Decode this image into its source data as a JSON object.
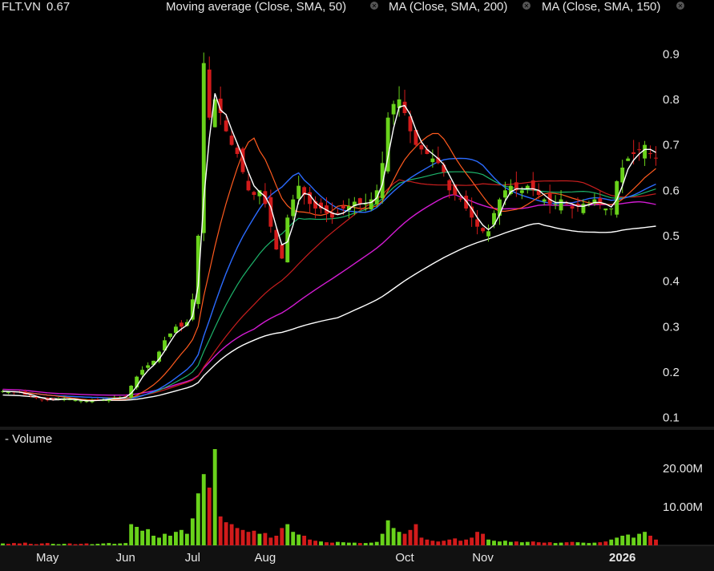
{
  "header": {
    "symbol": "FLT.VN",
    "last": "0.67",
    "indicators": [
      {
        "label": "Moving average (Close, SMA, 50)",
        "color": "#2b6bff"
      },
      {
        "label": "MA (Close, SMA, 200)",
        "color": "#ffffff"
      },
      {
        "label": "MA (Close, SMA, 150)",
        "color": "#d21bd2"
      }
    ]
  },
  "volume_pane": {
    "title": "- Volume"
  },
  "chart_data": [
    {
      "type": "candlestick",
      "ylim": [
        0.08,
        0.98
      ],
      "y_ticks": [
        "0.9",
        "0.8",
        "0.7",
        "0.6",
        "0.5",
        "0.4",
        "0.3",
        "0.2",
        "0.1"
      ],
      "y_tick_values": [
        0.9,
        0.8,
        0.7,
        0.6,
        0.5,
        0.4,
        0.3,
        0.2,
        0.1
      ],
      "x_months": [
        "May",
        "Jun",
        "Jul",
        "Aug",
        "Oct",
        "Nov",
        "2026"
      ],
      "x_month_index": [
        8,
        22,
        34,
        47,
        72,
        86,
        111
      ],
      "x_count": 118,
      "close": [
        0.158,
        0.157,
        0.156,
        0.155,
        0.15,
        0.148,
        0.143,
        0.14,
        0.138,
        0.139,
        0.141,
        0.142,
        0.14,
        0.138,
        0.137,
        0.136,
        0.138,
        0.139,
        0.14,
        0.141,
        0.143,
        0.144,
        0.146,
        0.17,
        0.19,
        0.205,
        0.215,
        0.225,
        0.245,
        0.27,
        0.285,
        0.3,
        0.3,
        0.31,
        0.36,
        0.5,
        0.88,
        0.76,
        0.8,
        0.77,
        0.73,
        0.7,
        0.68,
        0.64,
        0.6,
        0.59,
        0.6,
        0.57,
        0.52,
        0.47,
        0.45,
        0.54,
        0.58,
        0.61,
        0.59,
        0.57,
        0.56,
        0.56,
        0.55,
        0.54,
        0.55,
        0.56,
        0.565,
        0.575,
        0.57,
        0.57,
        0.58,
        0.6,
        0.66,
        0.76,
        0.79,
        0.8,
        0.77,
        0.73,
        0.7,
        0.69,
        0.68,
        0.67,
        0.66,
        0.64,
        0.6,
        0.59,
        0.58,
        0.56,
        0.54,
        0.52,
        0.51,
        0.51,
        0.55,
        0.58,
        0.6,
        0.61,
        0.6,
        0.6,
        0.61,
        0.6,
        0.59,
        0.58,
        0.57,
        0.57,
        0.58,
        0.57,
        0.56,
        0.565,
        0.57,
        0.57,
        0.58,
        0.57,
        0.56,
        0.56,
        0.62,
        0.65,
        0.67,
        0.68,
        0.69,
        0.7,
        0.68,
        0.67
      ],
      "ma_fast_color": "#ffffff",
      "ma_mid_color": "#ff5a1e",
      "colors": {
        "up": "#69d21b",
        "down": "#d21b1b"
      }
    },
    {
      "type": "bar",
      "title": "Volume",
      "ylim": [
        0,
        25000000
      ],
      "y_ticks": [
        "20.00M",
        "10.00M"
      ],
      "y_tick_values": [
        20000000,
        10000000
      ],
      "values": [
        0.5,
        0.4,
        0.6,
        0.5,
        0.7,
        0.4,
        0.3,
        0.5,
        0.6,
        0.4,
        0.3,
        0.4,
        0.5,
        0.3,
        0.4,
        0.5,
        0.3,
        0.4,
        0.5,
        0.6,
        0.4,
        0.5,
        0.6,
        5.5,
        4.8,
        3.8,
        4.2,
        2.5,
        2.0,
        3.0,
        2.5,
        3.5,
        4.0,
        3.0,
        7.0,
        13.5,
        18.5,
        15.0,
        25.0,
        7.5,
        6.0,
        5.5,
        4.5,
        4.0,
        3.5,
        3.8,
        3.0,
        3.2,
        2.0,
        2.5,
        4.5,
        5.5,
        3.5,
        2.8,
        2.5,
        1.5,
        1.2,
        1.0,
        0.8,
        0.7,
        0.9,
        0.8,
        0.7,
        0.7,
        0.6,
        0.6,
        0.7,
        0.9,
        3.0,
        6.5,
        4.5,
        3.5,
        3.0,
        4.0,
        5.5,
        2.0,
        1.5,
        1.2,
        1.0,
        1.2,
        1.5,
        1.8,
        1.2,
        1.5,
        2.0,
        3.5,
        3.0,
        1.5,
        1.2,
        1.0,
        1.2,
        0.9,
        1.0,
        0.8,
        0.9,
        1.0,
        0.8,
        0.7,
        0.8,
        0.6,
        0.7,
        0.8,
        0.9,
        0.8,
        0.7,
        0.6,
        0.7,
        0.8,
        1.0,
        1.5,
        2.0,
        2.5,
        2.8,
        2.0,
        3.0,
        3.5,
        2.5,
        1.5
      ],
      "value_unit_multiplier": 1000000
    }
  ]
}
